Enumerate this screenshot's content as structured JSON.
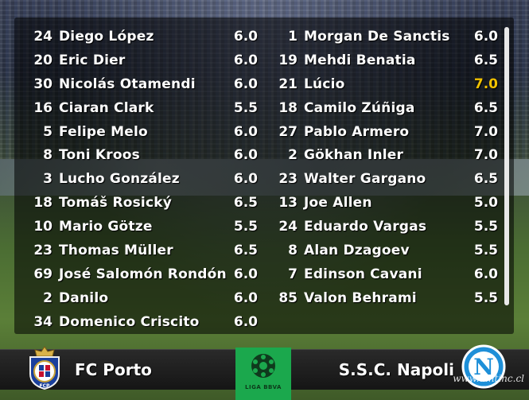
{
  "lineups": {
    "home": [
      {
        "number": "24",
        "name": "Diego López",
        "rating": "6.0"
      },
      {
        "number": "20",
        "name": "Eric Dier",
        "rating": "6.0"
      },
      {
        "number": "30",
        "name": "Nicolás Otamendi",
        "rating": "6.0"
      },
      {
        "number": "16",
        "name": "Ciaran Clark",
        "rating": "5.5"
      },
      {
        "number": "5",
        "name": "Felipe Melo",
        "rating": "6.0"
      },
      {
        "number": "8",
        "name": "Toni Kroos",
        "rating": "6.0"
      },
      {
        "number": "3",
        "name": "Lucho González",
        "rating": "6.0"
      },
      {
        "number": "18",
        "name": "Tomáš Rosický",
        "rating": "6.5"
      },
      {
        "number": "10",
        "name": "Mario Götze",
        "rating": "5.5"
      },
      {
        "number": "23",
        "name": "Thomas Müller",
        "rating": "6.5"
      },
      {
        "number": "69",
        "name": "José Salomón Rondón",
        "rating": "6.0"
      },
      {
        "number": "2",
        "name": "Danilo",
        "rating": "6.0"
      },
      {
        "number": "34",
        "name": "Domenico Criscito",
        "rating": "6.0"
      }
    ],
    "away": [
      {
        "number": "1",
        "name": "Morgan De Sanctis",
        "rating": "6.0"
      },
      {
        "number": "19",
        "name": "Mehdi Benatia",
        "rating": "6.5"
      },
      {
        "number": "21",
        "name": "Lúcio",
        "rating": "7.0",
        "highlight": true
      },
      {
        "number": "18",
        "name": "Camilo Zúñiga",
        "rating": "6.5"
      },
      {
        "number": "27",
        "name": "Pablo Armero",
        "rating": "7.0"
      },
      {
        "number": "2",
        "name": "Gökhan Inler",
        "rating": "7.0"
      },
      {
        "number": "23",
        "name": "Walter Gargano",
        "rating": "6.5"
      },
      {
        "number": "13",
        "name": "Joe Allen",
        "rating": "5.0"
      },
      {
        "number": "24",
        "name": "Eduardo Vargas",
        "rating": "5.5"
      },
      {
        "number": "8",
        "name": "Alan Dzagoev",
        "rating": "5.5"
      },
      {
        "number": "7",
        "name": "Edinson Cavani",
        "rating": "6.0"
      },
      {
        "number": "85",
        "name": "Valon Behrami",
        "rating": "5.5"
      }
    ]
  },
  "teams": {
    "home_name": "FC Porto",
    "away_name": "S.S.C. Napoli",
    "home_crest_text": "FCP",
    "away_crest_text": "N"
  },
  "league": {
    "label": "LIGA BBVA"
  },
  "watermark": "www.dmtinc.cl",
  "colors": {
    "highlight": "#f2c200",
    "league_green": "#1ba84d",
    "napoli_blue": "#1e8fd8",
    "porto_blue": "#1a3f9c"
  }
}
